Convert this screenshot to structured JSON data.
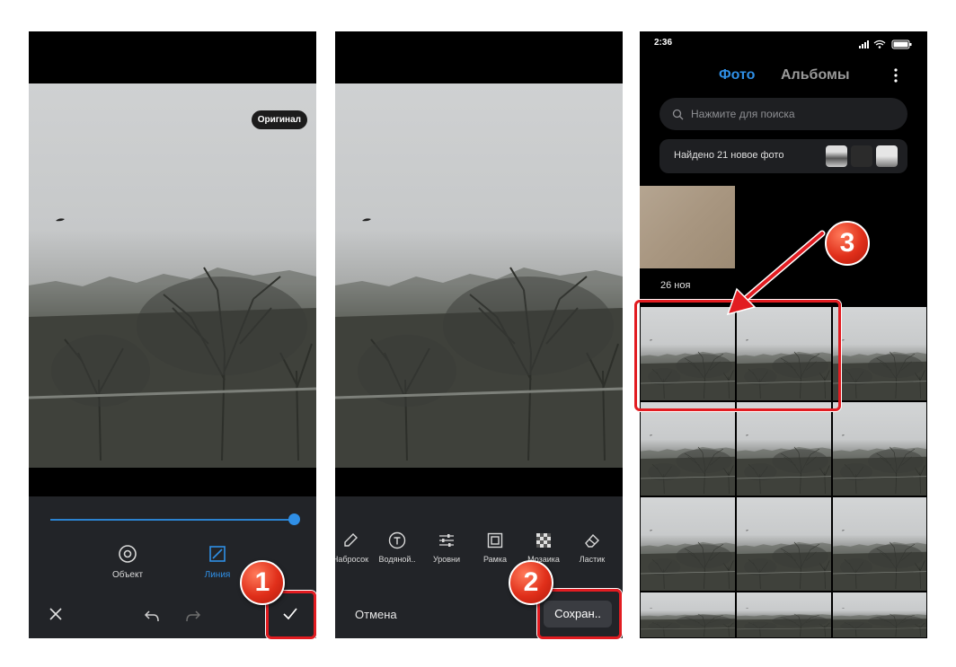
{
  "editor": {
    "original_label": "Оригинал",
    "tools": [
      {
        "label": "Объект",
        "icon": "target-icon"
      },
      {
        "label": "Линия",
        "icon": "line-square-icon"
      }
    ],
    "slider_level": 0.99
  },
  "editor2": {
    "tools": [
      {
        "label": "Набросок",
        "icon": "eraser-pen-icon"
      },
      {
        "label": "Водяной..",
        "icon": "text-t-icon"
      },
      {
        "label": "Уровни",
        "icon": "sliders-icon"
      },
      {
        "label": "Рамка",
        "icon": "frame-icon"
      },
      {
        "label": "Мозаика",
        "icon": "mosaic-icon"
      },
      {
        "label": "Ластик",
        "icon": "eraser-icon"
      }
    ],
    "cancel_label": "Отмена",
    "save_label": "Сохран.."
  },
  "gallery": {
    "time": "2:36",
    "tabs": [
      "Фото",
      "Альбомы"
    ],
    "search_placeholder": "Нажмите для поиска",
    "found_text": "Найдено 21 новое фото",
    "date_label": "26 ноя"
  },
  "annotations": {
    "step1": "1",
    "step2": "2",
    "step3": "3",
    "highlight_color": "#e21c21"
  },
  "colors": {
    "accent": "#2f8fe6",
    "panel": "#222428"
  }
}
